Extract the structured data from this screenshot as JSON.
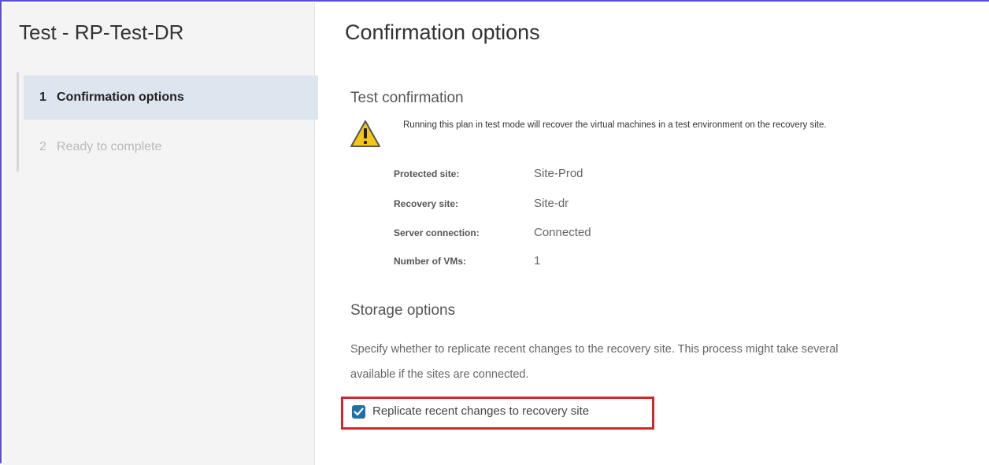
{
  "wizard": {
    "title": "Test - RP-Test-DR",
    "steps": [
      {
        "number": "1",
        "label": "Confirmation options",
        "state": "active"
      },
      {
        "number": "2",
        "label": "Ready to complete",
        "state": "inactive"
      }
    ]
  },
  "main": {
    "title": "Confirmation options",
    "test_confirmation": {
      "heading": "Test confirmation",
      "warning_icon": "warning-triangle-icon",
      "warning_text": "Running this plan in test mode will recover the virtual machines in a test environment on the recovery site.",
      "properties": [
        {
          "label": "Protected site:",
          "value": "Site-Prod"
        },
        {
          "label": "Recovery site:",
          "value": "Site-dr"
        },
        {
          "label": "Server connection:",
          "value": "Connected"
        },
        {
          "label": "Number of VMs:",
          "value": "1"
        }
      ]
    },
    "storage_options": {
      "heading": "Storage options",
      "description_line1": "Specify whether to replicate recent changes to the recovery site. This process might take several",
      "description_line2": "available if the sites are connected.",
      "checkbox_label": "Replicate recent changes to recovery site",
      "checkbox_checked": true
    }
  },
  "colors": {
    "accent": "#1f6fa8",
    "highlight_border": "#d3262c",
    "warning_fill": "#f5c518",
    "active_step_bg": "#dde5ee"
  }
}
